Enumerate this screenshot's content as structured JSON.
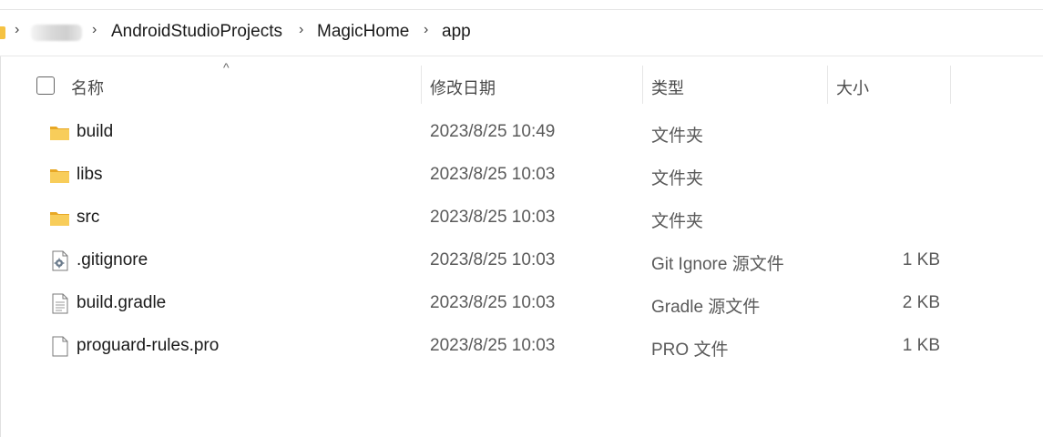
{
  "address": {
    "crumbs": [
      "AndroidStudioProjects",
      "MagicHome",
      "app"
    ]
  },
  "columns": {
    "name": "名称",
    "modified": "修改日期",
    "type": "类型",
    "size": "大小"
  },
  "files": [
    {
      "name": "build",
      "modified": "2023/8/25 10:49",
      "type": "文件夹",
      "size": "",
      "icon": "folder-icon"
    },
    {
      "name": "libs",
      "modified": "2023/8/25 10:03",
      "type": "文件夹",
      "size": "",
      "icon": "folder-icon"
    },
    {
      "name": "src",
      "modified": "2023/8/25 10:03",
      "type": "文件夹",
      "size": "",
      "icon": "folder-icon"
    },
    {
      "name": ".gitignore",
      "modified": "2023/8/25 10:03",
      "type": "Git Ignore 源文件",
      "size": "1 KB",
      "icon": "gear-file-icon"
    },
    {
      "name": "build.gradle",
      "modified": "2023/8/25 10:03",
      "type": "Gradle 源文件",
      "size": "2 KB",
      "icon": "text-file-icon"
    },
    {
      "name": "proguard-rules.pro",
      "modified": "2023/8/25 10:03",
      "type": "PRO 文件",
      "size": "1 KB",
      "icon": "blank-file-icon"
    }
  ],
  "colors": {
    "folder": "#f5c242",
    "folder_dark": "#e8a825"
  }
}
